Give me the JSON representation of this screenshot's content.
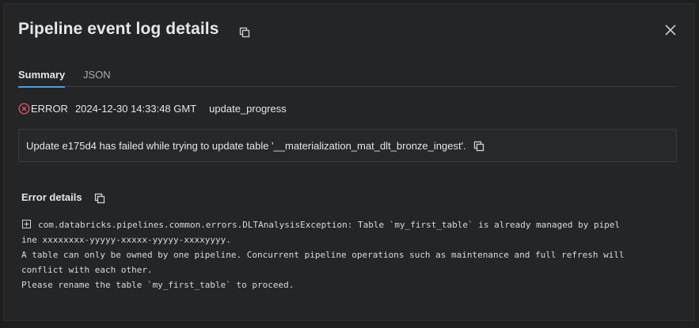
{
  "dialog": {
    "title": "Pipeline event log details"
  },
  "tabs": [
    {
      "label": "Summary",
      "active": true
    },
    {
      "label": "JSON",
      "active": false
    }
  ],
  "event": {
    "level": "ERROR",
    "timestamp": "2024-12-30 14:33:48 GMT",
    "event_type": "update_progress",
    "message": "Update e175d4 has failed while trying to update table '__materialization_mat_dlt_bronze_ingest'."
  },
  "error_details": {
    "title": "Error details",
    "lines": [
      "com.databricks.pipelines.common.errors.DLTAnalysisException: Table `my_first_table` is already managed by pipel",
      "ine xxxxxxxx-yyyyy-xxxxx-yyyyy-xxxxyyyy.",
      "A table can only be owned by one pipeline. Concurrent pipeline operations such as maintenance and full refresh will",
      "conflict with each other.",
      "Please rename the table `my_first_table` to proceed."
    ]
  },
  "colors": {
    "background": "#232527",
    "accent": "#4a9ee8",
    "error": "#e05560",
    "border": "#3b3e42"
  },
  "icons": [
    "copy-icon",
    "close-icon",
    "error-icon",
    "expand-icon"
  ]
}
